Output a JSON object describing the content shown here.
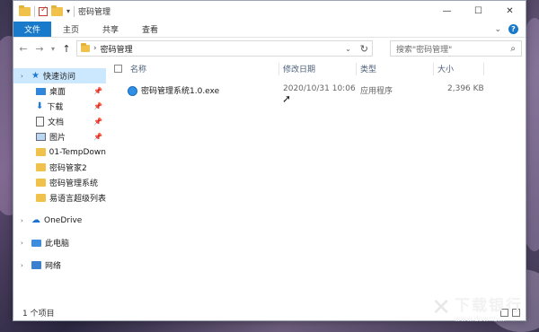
{
  "window": {
    "title": "密码管理",
    "controls": {
      "minimize": "—",
      "maximize": "☐",
      "close": "✕"
    }
  },
  "ribbon": {
    "tabs": [
      "文件",
      "主页",
      "共享",
      "查看"
    ],
    "active_tab": "文件",
    "expand": "⌄",
    "help": "?"
  },
  "address": {
    "path": "密码管理",
    "search_placeholder": "搜索\"密码管理\""
  },
  "sidebar": {
    "quick_access": "快速访问",
    "items": [
      {
        "label": "桌面",
        "pinned": true
      },
      {
        "label": "下载",
        "pinned": true
      },
      {
        "label": "文档",
        "pinned": true
      },
      {
        "label": "图片",
        "pinned": true
      },
      {
        "label": "01-TempDown"
      },
      {
        "label": "密码管家2"
      },
      {
        "label": "密码管理系统"
      },
      {
        "label": "易语言超级列表"
      }
    ],
    "onedrive": "OneDrive",
    "this_pc": "此电脑",
    "network": "网络"
  },
  "columns": {
    "name": "名称",
    "modified": "修改日期",
    "type": "类型",
    "size": "大小"
  },
  "files": [
    {
      "name": "密码管理系统1.0.exe",
      "modified": "2020/10/31 10:06",
      "type": "应用程序",
      "size": "2,396 KB"
    }
  ],
  "status": {
    "count": "1 个项目"
  },
  "watermark": {
    "cn": "下载银行",
    "en": "www.downb..."
  }
}
